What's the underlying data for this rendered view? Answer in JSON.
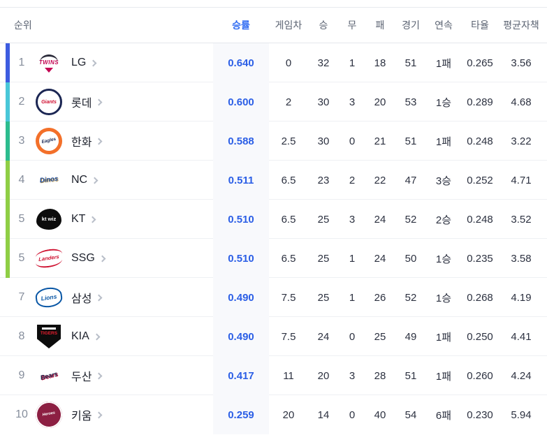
{
  "colors": {
    "accent_blue": "#2f6bf2",
    "value_blue": "#2c5fe6",
    "winrate_col_bg": "#f8f9fc",
    "header_text": "#5b6372",
    "rank_text": "#868e9c",
    "row_divider": "#eef0f3"
  },
  "table": {
    "headers": {
      "rank": "순위",
      "win_rate": "승률",
      "games_behind": "게임차",
      "wins": "승",
      "draws": "무",
      "losses": "패",
      "games": "경기",
      "streak": "연속",
      "batting_avg": "타율",
      "era": "평균자책"
    },
    "sorted_column": "win_rate",
    "rows": [
      {
        "rank": "1",
        "team": "LG",
        "bar_color": "#3d5ce0",
        "logo": {
          "name": "lg-twins-logo",
          "shape": "twins",
          "text": "TWINS",
          "fg": "#c30452",
          "bg": "",
          "border": "",
          "accent": "#c30452"
        },
        "win_rate": "0.640",
        "games_behind": "0",
        "wins": "32",
        "draws": "1",
        "losses": "18",
        "games": "51",
        "streak": "1패",
        "batting_avg": "0.265",
        "era": "3.56"
      },
      {
        "rank": "2",
        "team": "롯데",
        "bar_color": "#49c7d8",
        "logo": {
          "name": "lotte-giants-logo",
          "shape": "giants",
          "text": "Giants",
          "fg": "#d00f31",
          "bg": "#ffffff",
          "border": "#1b2653",
          "accent": "#1b2653"
        },
        "win_rate": "0.600",
        "games_behind": "2",
        "wins": "30",
        "draws": "3",
        "losses": "20",
        "games": "53",
        "streak": "1승",
        "batting_avg": "0.289",
        "era": "4.68"
      },
      {
        "rank": "3",
        "team": "한화",
        "bar_color": "#2cbc8e",
        "logo": {
          "name": "hanwha-eagles-logo",
          "shape": "eagles",
          "text": "Eagles",
          "fg": "#1c2a56",
          "bg": "#ffffff",
          "border": "#f3702a",
          "accent": "#f3702a"
        },
        "win_rate": "0.588",
        "games_behind": "2.5",
        "wins": "30",
        "draws": "0",
        "losses": "21",
        "games": "51",
        "streak": "1패",
        "batting_avg": "0.248",
        "era": "3.22"
      },
      {
        "rank": "4",
        "team": "NC",
        "bar_color": "#8fce45",
        "logo": {
          "name": "nc-dinos-logo",
          "shape": "dinos",
          "text": "Dinos",
          "fg": "#204d9b",
          "bg": "",
          "border": "",
          "accent": "#b5985a"
        },
        "win_rate": "0.511",
        "games_behind": "6.5",
        "wins": "23",
        "draws": "2",
        "losses": "22",
        "games": "47",
        "streak": "3승",
        "batting_avg": "0.252",
        "era": "4.71"
      },
      {
        "rank": "5",
        "team": "KT",
        "bar_color": "#8fce45",
        "logo": {
          "name": "kt-wiz-logo",
          "shape": "ktwiz",
          "text": "kt wiz",
          "fg": "#ffffff",
          "bg": "#0c0c0c",
          "border": "",
          "accent": "#e0202c"
        },
        "win_rate": "0.510",
        "games_behind": "6.5",
        "wins": "25",
        "draws": "3",
        "losses": "24",
        "games": "52",
        "streak": "2승",
        "batting_avg": "0.248",
        "era": "3.52"
      },
      {
        "rank": "5",
        "team": "SSG",
        "bar_color": "#8fce45",
        "logo": {
          "name": "ssg-landers-logo",
          "shape": "landers",
          "text": "Landers",
          "fg": "#ce0e2d",
          "bg": "",
          "border": "#ce0e2d",
          "accent": "#ce0e2d"
        },
        "win_rate": "0.510",
        "games_behind": "6.5",
        "wins": "25",
        "draws": "1",
        "losses": "24",
        "games": "50",
        "streak": "1승",
        "batting_avg": "0.235",
        "era": "3.58"
      },
      {
        "rank": "7",
        "team": "삼성",
        "bar_color": "",
        "logo": {
          "name": "samsung-lions-logo",
          "shape": "lions",
          "text": "Lions",
          "fg": "#0856a5",
          "bg": "",
          "border": "#0856a5",
          "accent": "#0856a5"
        },
        "win_rate": "0.490",
        "games_behind": "7.5",
        "wins": "25",
        "draws": "1",
        "losses": "26",
        "games": "52",
        "streak": "1승",
        "batting_avg": "0.268",
        "era": "4.19"
      },
      {
        "rank": "8",
        "team": "KIA",
        "bar_color": "",
        "logo": {
          "name": "kia-tigers-logo",
          "shape": "tigers",
          "text": "TIGERS",
          "fg": "#ea1c2d",
          "bg": "#0c0c0c",
          "border": "",
          "accent": "#ea1c2d"
        },
        "win_rate": "0.490",
        "games_behind": "7.5",
        "wins": "24",
        "draws": "0",
        "losses": "25",
        "games": "49",
        "streak": "1패",
        "batting_avg": "0.250",
        "era": "4.41"
      },
      {
        "rank": "9",
        "team": "두산",
        "bar_color": "",
        "logo": {
          "name": "doosan-bears-logo",
          "shape": "bears",
          "text": "Bears",
          "fg": "#1a2149",
          "bg": "",
          "border": "",
          "accent": "#c4113a"
        },
        "win_rate": "0.417",
        "games_behind": "11",
        "wins": "20",
        "draws": "3",
        "losses": "28",
        "games": "51",
        "streak": "1패",
        "batting_avg": "0.260",
        "era": "4.24"
      },
      {
        "rank": "10",
        "team": "키움",
        "bar_color": "",
        "logo": {
          "name": "kiwoom-heroes-logo",
          "shape": "heroes",
          "text": "Heroes",
          "fg": "#ffffff",
          "bg": "#8c1f42",
          "border": "#8c1f42",
          "accent": "#8c1f42"
        },
        "win_rate": "0.259",
        "games_behind": "20",
        "wins": "14",
        "draws": "0",
        "losses": "40",
        "games": "54",
        "streak": "6패",
        "batting_avg": "0.230",
        "era": "5.94"
      }
    ]
  }
}
